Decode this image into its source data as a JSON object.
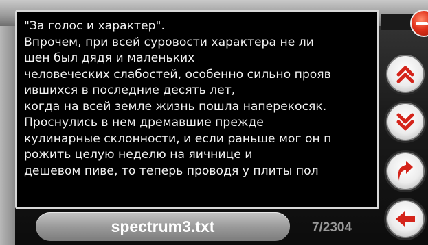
{
  "reader": {
    "lines": [
      "\"За голос и характер\".",
      "   Впрочем, при всей суровости характера не ли",
      "шен был дядя и маленьких",
      "человеческих слабостей, особенно сильно прояв",
      "ившихся в последние десять лет,",
      "когда на всей земле жизнь пошла наперекосяк.",
      "Проснулись в нем дремавшие прежде",
      "кулинарные склонности, и если раньше мог он п",
      "рожить целую неделю на яичнице и",
      "дешевом пиве, то теперь проводя у плиты пол"
    ]
  },
  "footer": {
    "filename": "spectrum3.txt",
    "page_counter": "7/2304"
  },
  "controls": {
    "page_up": "double-chevron-up-icon",
    "page_down": "double-chevron-down-icon",
    "go_to": "curved-arrow-up-icon",
    "back": "arrow-left-icon",
    "close": "minus-icon"
  },
  "colors": {
    "accent_red": "#e2321b",
    "text": "#f2f2f2",
    "screen_bg": "#000000"
  }
}
